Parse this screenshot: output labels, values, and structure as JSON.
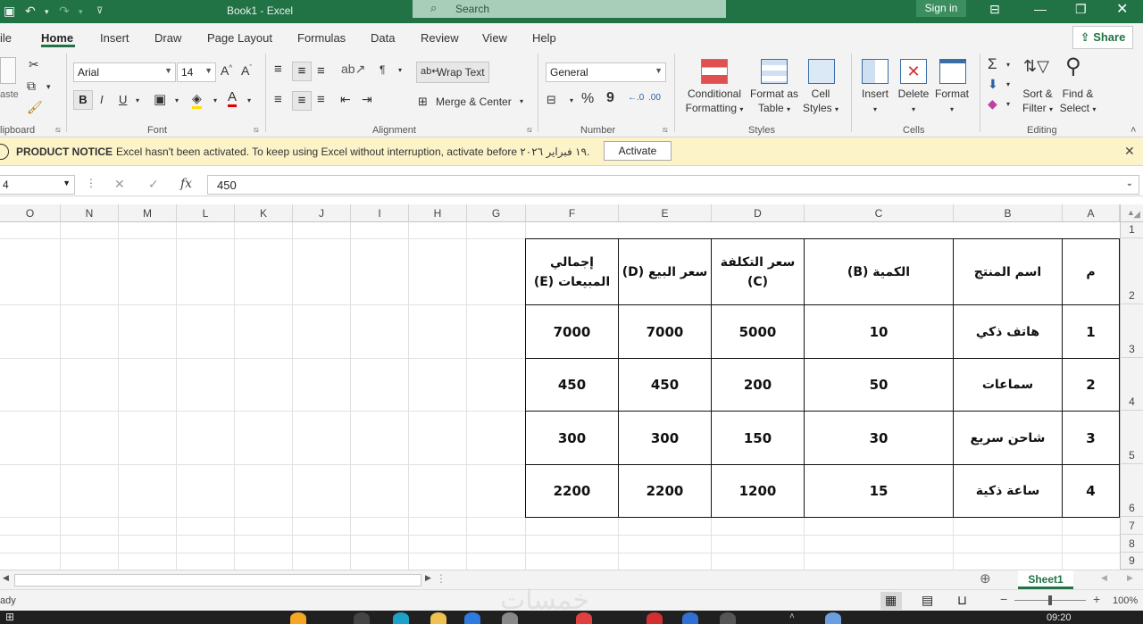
{
  "titlebar": {
    "title": "Book1  -  Excel",
    "search_placeholder": "Search",
    "signin": "Sign in"
  },
  "menu": {
    "tabs": [
      "ile",
      "Home",
      "Insert",
      "Draw",
      "Page Layout",
      "Formulas",
      "Data",
      "Review",
      "View",
      "Help"
    ],
    "share": "Share"
  },
  "ribbon": {
    "clipboard": {
      "paste": "aste",
      "group": "lipboard"
    },
    "font": {
      "name": "Arial",
      "size": "14",
      "group": "Font",
      "bold": "B",
      "italic": "I",
      "underline": "U"
    },
    "alignment": {
      "wrap": "Wrap Text",
      "merge": "Merge & Center",
      "group": "Alignment"
    },
    "number": {
      "format": "General",
      "group": "Number"
    },
    "styles": {
      "conditional": "Conditional",
      "formatting": "Formatting",
      "format_as": "Format as",
      "table": "Table",
      "cell": "Cell",
      "cell_styles": "Styles",
      "group": "Styles"
    },
    "cells": {
      "insert": "Insert",
      "delete": "Delete",
      "format": "Format",
      "group": "Cells"
    },
    "editing": {
      "sort": "Sort &",
      "filter": "Filter",
      "find": "Find &",
      "select": "Select",
      "group": "Editing"
    }
  },
  "notice": {
    "title": "PRODUCT NOTICE",
    "message": "Excel hasn't been activated. To keep using Excel without interruption, activate before ١٩ فبراير ٢٠٢٦.",
    "activate": "Activate"
  },
  "formula_bar": {
    "name_box": "4",
    "value": "450"
  },
  "columns": [
    "O",
    "N",
    "M",
    "L",
    "K",
    "J",
    "I",
    "H",
    "G",
    "F",
    "E",
    "D",
    "C",
    "B",
    "A"
  ],
  "rows": [
    "1",
    "2",
    "3",
    "4",
    "5",
    "6",
    "7",
    "8",
    "9"
  ],
  "table": {
    "headers": [
      "م",
      "اسم المنتج",
      "الكمية (B)",
      "سعر التكلفة (C)",
      "سعر البيع (D)",
      "إجمالي المبيعات (E)"
    ],
    "rows": [
      [
        "1",
        "هاتف ذكي",
        "10",
        "5000",
        "7000",
        "7000"
      ],
      [
        "2",
        "سماعات",
        "50",
        "200",
        "450",
        "450"
      ],
      [
        "3",
        "شاحن سريع",
        "30",
        "150",
        "300",
        "300"
      ],
      [
        "4",
        "ساعة ذكية",
        "15",
        "1200",
        "2200",
        "2200"
      ]
    ]
  },
  "sheet_tabs": {
    "active": "Sheet1"
  },
  "status_bar": {
    "left": "ady",
    "zoom": "100%",
    "watermark": "خمسات"
  },
  "taskbar": {
    "time": "09:20"
  }
}
